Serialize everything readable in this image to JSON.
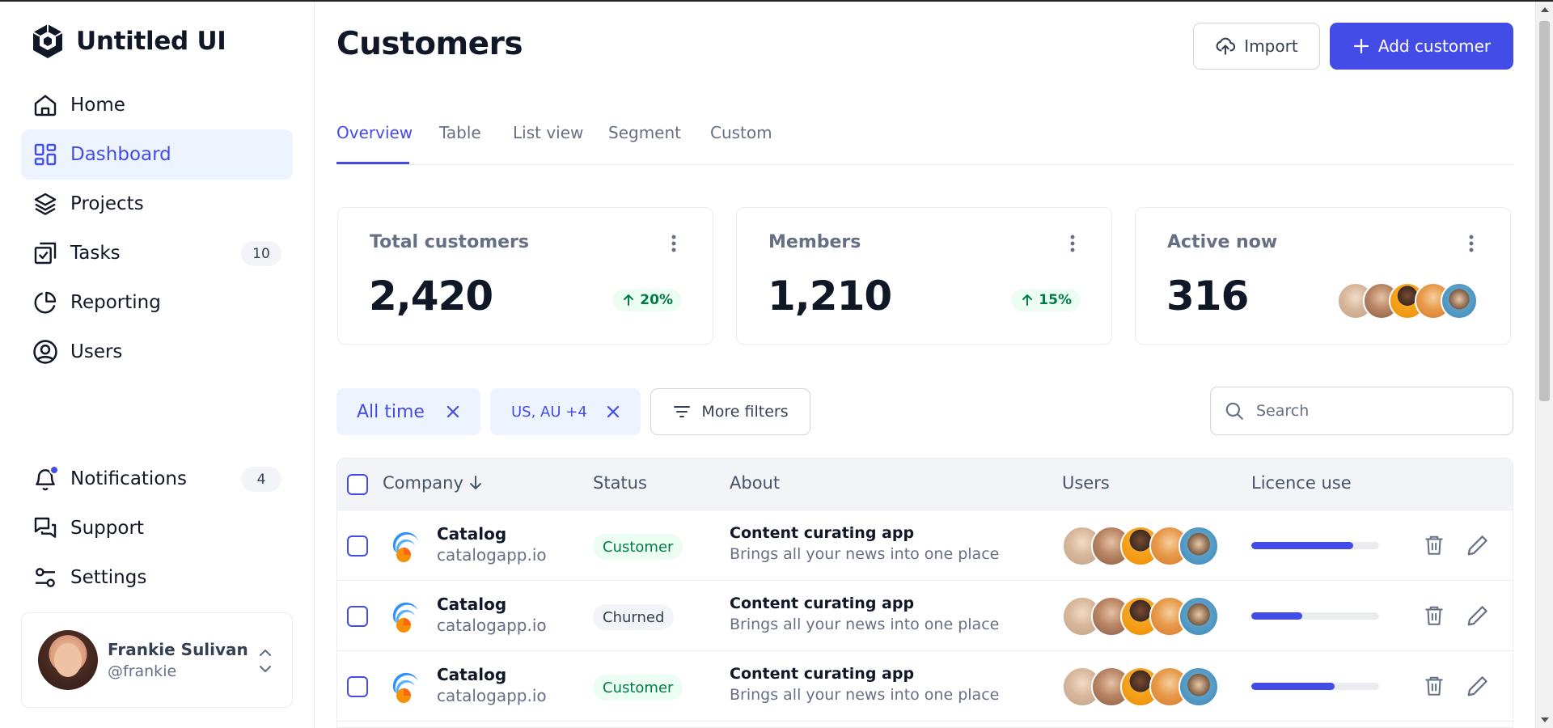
{
  "app": {
    "name": "Untitled UI"
  },
  "sidebar": {
    "items": [
      {
        "label": "Home",
        "icon": "home-icon"
      },
      {
        "label": "Dashboard",
        "icon": "dashboard-icon",
        "active": true
      },
      {
        "label": "Projects",
        "icon": "layers-icon"
      },
      {
        "label": "Tasks",
        "icon": "check-square-icon",
        "badge": "10"
      },
      {
        "label": "Reporting",
        "icon": "pie-chart-icon"
      },
      {
        "label": "Users",
        "icon": "user-icon"
      }
    ],
    "bottom_items": [
      {
        "label": "Notifications",
        "icon": "bell-icon",
        "badge": "4"
      },
      {
        "label": "Support",
        "icon": "message-icon"
      },
      {
        "label": "Settings",
        "icon": "settings-icon"
      }
    ],
    "user": {
      "name": "Frankie Sulivan",
      "handle": "@frankie"
    }
  },
  "header": {
    "title": "Customers",
    "import_label": "Import",
    "add_label": "Add customer"
  },
  "tabs": [
    {
      "label": "Overview",
      "active": true
    },
    {
      "label": "Table"
    },
    {
      "label": "List view"
    },
    {
      "label": "Segment"
    },
    {
      "label": "Custom"
    }
  ],
  "stats": [
    {
      "title": "Total customers",
      "value": "2,420",
      "trend": "20%"
    },
    {
      "title": "Members",
      "value": "1,210",
      "trend": "15%"
    },
    {
      "title": "Active now",
      "value": "316"
    }
  ],
  "filters": {
    "chip_time": "All time",
    "chip_region": "US, AU +4",
    "more_label": "More filters",
    "search_placeholder": "Search"
  },
  "table": {
    "columns": [
      "Company",
      "Status",
      "About",
      "Users",
      "Licence use"
    ],
    "rows": [
      {
        "company": "Catalog",
        "url": "catalogapp.io",
        "status": "Customer",
        "about_title": "Content curating app",
        "about_desc": "Brings all your news into one place",
        "licence": 0.8
      },
      {
        "company": "Catalog",
        "url": "catalogapp.io",
        "status": "Churned",
        "about_title": "Content curating app",
        "about_desc": "Brings all your news into one place",
        "licence": 0.4
      },
      {
        "company": "Catalog",
        "url": "catalogapp.io",
        "status": "Customer",
        "about_title": "Content curating app",
        "about_desc": "Brings all your news into one place",
        "licence": 0.65
      }
    ]
  },
  "colors": {
    "accent": "#444ce7",
    "accent_light": "#eef4ff",
    "success_bg": "#ecfdf3",
    "success_text": "#027a48"
  }
}
